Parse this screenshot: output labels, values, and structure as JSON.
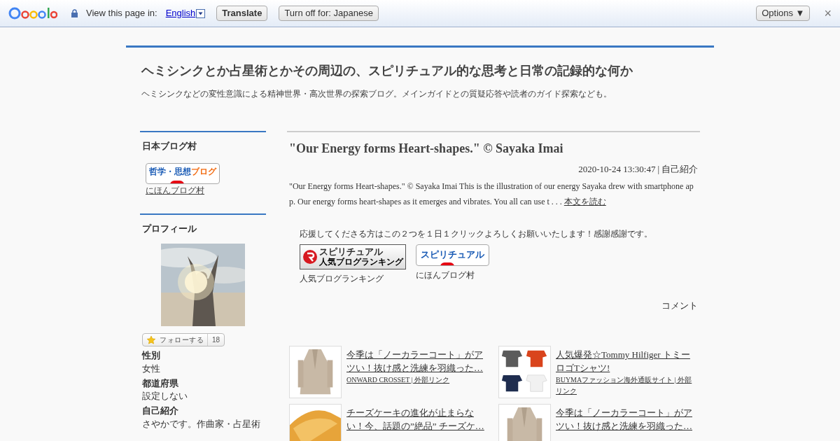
{
  "translate_bar": {
    "label": "View this page in:",
    "language": "English",
    "buttons": [
      "Translate",
      "Turn off for: Japanese"
    ],
    "options": "Options ▼",
    "close": "×"
  },
  "blog": {
    "title": "ヘミシンクとか占星術とかその周辺の、スピリチュアル的な思考と日常の記録的な何か",
    "subtitle": "ヘミシンクなどの変性意識による精神世界・高次世界の探索ブログ。メインガイドとの質疑応答や読者のガイド探索なども。"
  },
  "sidebar": {
    "village": {
      "heading": "日本ブログ村",
      "banner": [
        "哲学・思想",
        "ブログ"
      ],
      "link": "にほんブログ村"
    },
    "profile": {
      "heading": "プロフィール",
      "follow": "フォローする",
      "follow_count": "18",
      "fields": [
        {
          "label": "性別",
          "value": "女性"
        },
        {
          "label": "都道府県",
          "value": "設定しない"
        },
        {
          "label": "自己紹介",
          "value": "さやかです。作曲家・占星術"
        }
      ]
    }
  },
  "post": {
    "title": "\"Our Energy forms Heart-shapes.\" © Sayaka Imai",
    "date": "2020-10-24 13:30:47",
    "separator": "|",
    "category": "自己紹介",
    "excerpt": "\"Our Energy forms Heart-shapes.\" © Sayaka Imai This is the illustration of our energy Sayaka drew with smartphone app. Our energy forms heart-shapes as it emerges and vibrates. You all can use t . . .",
    "read_more": "本文を読む",
    "support": "応援してくださる方はこの２つを１日１クリックよろしくお願いいたします！感謝感謝です。",
    "banners": [
      {
        "kind": "ranking",
        "title": "スピリチュアル",
        "sub": "人気ブログランキング",
        "caption": "人気ブログランキング"
      },
      {
        "kind": "village",
        "title": "スピリチュアル",
        "caption": "にほんブログ村"
      }
    ],
    "comment": "コメント"
  },
  "ads": [
    {
      "title": "今季は「ノーカラーコート」がアツい！抜け感と洗練を羽織った…",
      "source": "ONWARD CROSSET | 外部リンク"
    },
    {
      "title": "人気爆発☆Tommy Hilfiger トミーロゴTシャツ!",
      "source": "BUYMAファッション海外通販サイト | 外部リンク"
    },
    {
      "title": "チーズケーキの進化が止まらない！今、話題の”絶品” チーズケ…"
    },
    {
      "title": "今季は「ノーカラーコート」がアツい！抜け感と洗練を羽織った…"
    }
  ]
}
